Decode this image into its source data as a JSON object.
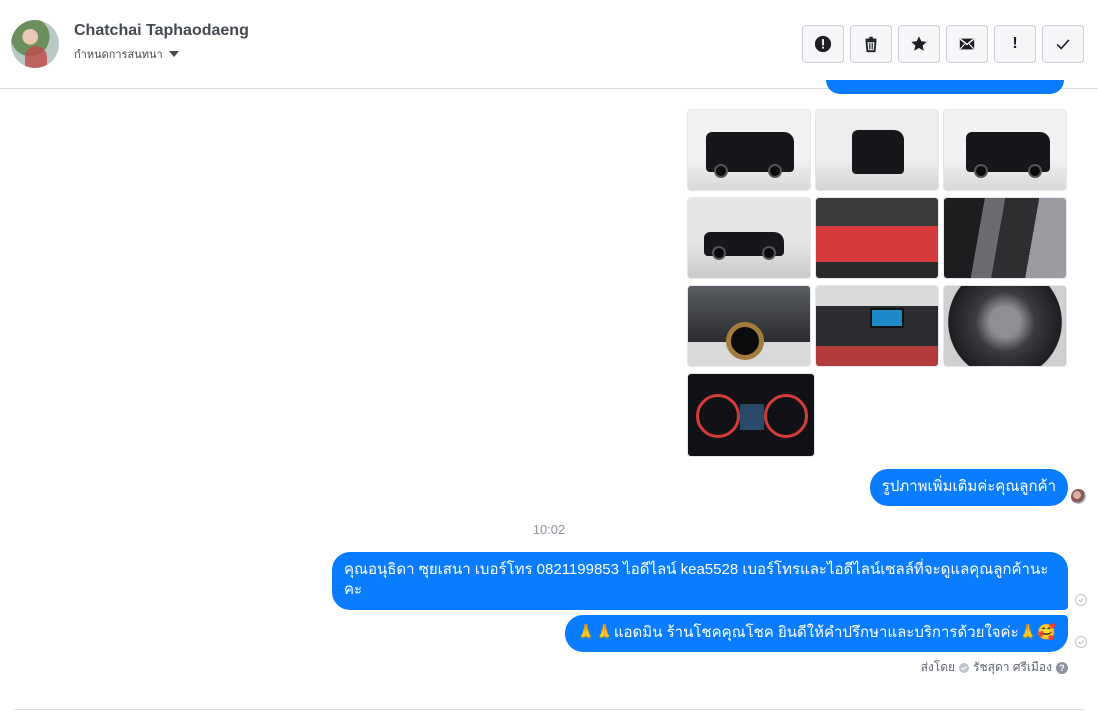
{
  "header": {
    "name": "Chatchai Taphaodaeng",
    "subtitle": "กำหนดการสนทนา",
    "actions": [
      "exclamation-circle",
      "trash",
      "star",
      "envelope",
      "!",
      "check"
    ]
  },
  "conversation": {
    "photo_count": 10,
    "messages": [
      {
        "text": "รูปภาพเพิ่มเติมค่ะคุณลูกค้า"
      },
      {
        "text": "คุณอนุธิดา ซุยเสนา        เบอร์โทร 0821199853   ไอดีไลน์ kea5528   เบอร์โทรและไอดีไลน์เซลล์ที่จะดูแลคุณลูกค้านะคะ"
      },
      {
        "text": "🙏🙏แอดมิน ร้านโชคคุณโชค ยินดีให้คำปรึกษาและบริการด้วยใจค่ะ🙏🥰"
      }
    ],
    "time_label": "10:02",
    "sent_by_label": "ส่งโดย",
    "sent_by_name": "รัชสุดา ศรีเมือง",
    "colors": {
      "bubble": "#0a7cff",
      "text_on_bubble": "#ffffff"
    }
  }
}
